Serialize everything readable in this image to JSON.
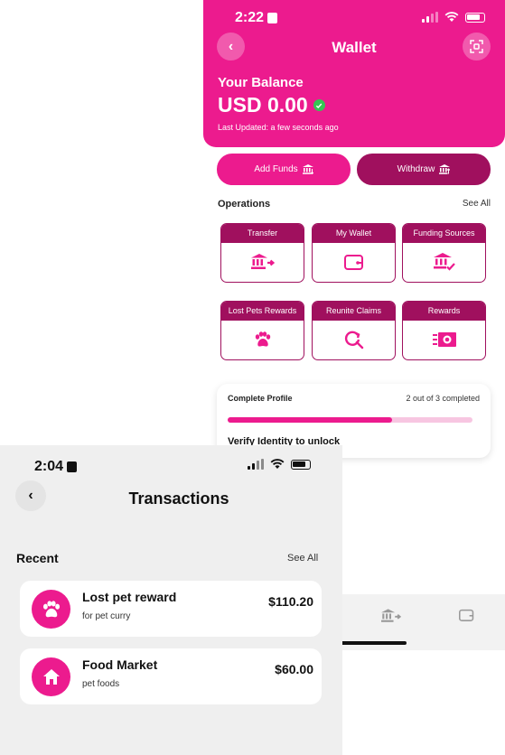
{
  "wallet": {
    "status_time": "2:22",
    "title": "Wallet",
    "balance_label": "Your Balance",
    "balance": "USD 0.00",
    "last_updated": "Last Updated: a few seconds ago",
    "add_funds_label": "Add Funds",
    "withdraw_label": "Withdraw",
    "operations_label": "Operations",
    "see_all_label": "See All",
    "operations": [
      {
        "label": "Transfer",
        "icon": "bank-transfer-icon"
      },
      {
        "label": "My Wallet",
        "icon": "wallet-icon"
      },
      {
        "label": "Funding Sources",
        "icon": "bank-check-icon"
      },
      {
        "label": "Lost Pets Rewards",
        "icon": "paw-icon"
      },
      {
        "label": "Reunite Claims",
        "icon": "search-refresh-icon"
      },
      {
        "label": "Rewards",
        "icon": "cash-icon"
      }
    ],
    "profile": {
      "title": "Complete Profile",
      "progress_text": "2 out of 3 completed",
      "progress": 0.67,
      "next_step": "Verify Identity to unlock"
    },
    "colors": {
      "accent": "#ec1b8e",
      "dark_accent": "#a0105e",
      "verified": "#35c553"
    }
  },
  "transactions": {
    "status_time": "2:04",
    "title": "Transactions",
    "recent_label": "Recent",
    "see_all_label": "See All",
    "items": [
      {
        "name": "Lost pet reward",
        "note": "for pet curry",
        "amount": "$110.20",
        "icon": "paw-icon"
      },
      {
        "name": "Food Market",
        "note": "pet foods",
        "amount": "$60.00",
        "icon": "home-icon"
      }
    ]
  }
}
